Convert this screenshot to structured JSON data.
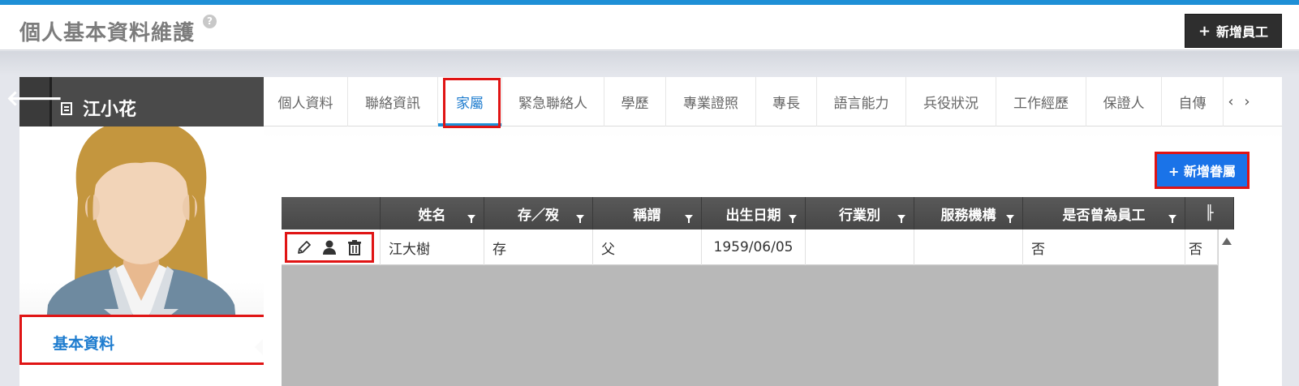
{
  "header": {
    "title": "個人基本資料維護",
    "help": "?",
    "add_employee_plus": "+",
    "add_employee_label": "新增員工"
  },
  "profile": {
    "back": "🡐",
    "name": "江小花"
  },
  "sidebar": {
    "items": [
      {
        "label": "基本資料"
      }
    ]
  },
  "tabs": [
    {
      "label": "個人資料"
    },
    {
      "label": "聯絡資訊"
    },
    {
      "label": "家屬"
    },
    {
      "label": "緊急聯絡人"
    },
    {
      "label": "學歷"
    },
    {
      "label": "專業證照"
    },
    {
      "label": "專長"
    },
    {
      "label": "語言能力"
    },
    {
      "label": "兵役狀況"
    },
    {
      "label": "工作經歷"
    },
    {
      "label": "保證人"
    },
    {
      "label": "自傳"
    }
  ],
  "tab_nav": {
    "prev": "‹",
    "next": "›"
  },
  "family": {
    "add_button": "+ 新增眷屬",
    "columns": [
      "姓名",
      "存／歿",
      "稱謂",
      "出生日期",
      "行業別",
      "服務機構",
      "是否曾為員工",
      "╟"
    ],
    "rows": [
      {
        "name": "江大樹",
        "status": "存",
        "relation": "父",
        "birth": "1959/06/05",
        "industry": "",
        "org": "",
        "was_employee": "否",
        "extra": "否"
      }
    ]
  },
  "colors": {
    "accent": "#1e8fd6",
    "primary_button": "#1a73e8",
    "highlight_box": "#e01414",
    "grid_header": "#4f4f4f"
  }
}
